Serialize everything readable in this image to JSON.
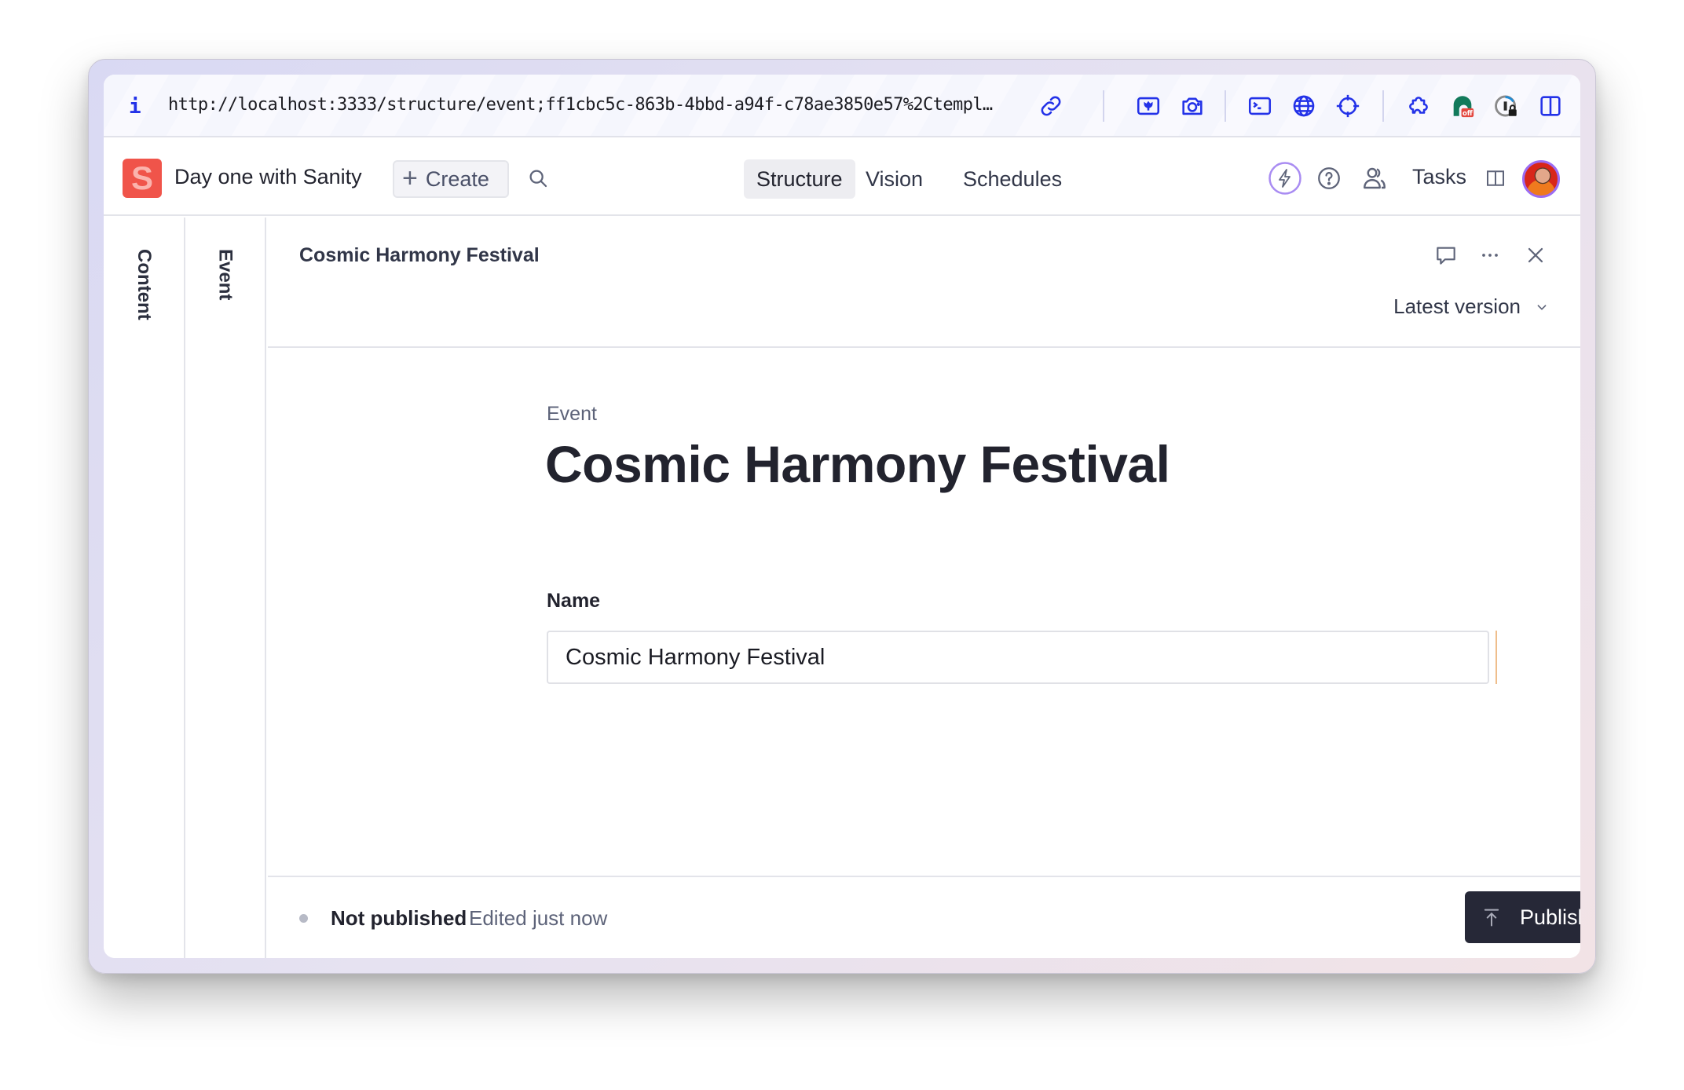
{
  "browser": {
    "url": "http://localhost:3333/structure/event;ff1cbc5c-863b-4bbd-a94f-c78ae3850e57%2Ctempl…",
    "info_icon": "i",
    "toolbar_icons": [
      "link-icon",
      "image-tool-icon",
      "camera-icon",
      "terminal-icon",
      "globe-icon",
      "crosshair-icon",
      "extension-puzzle-icon",
      "extension-off-icon",
      "password-manager-lock-icon",
      "sidebar-split-icon"
    ],
    "extension_badge": "off",
    "accent_color": "#2332e8"
  },
  "header": {
    "logo_letter": "S",
    "project_name": "Day one with Sanity",
    "create_label": "Create",
    "nav_tabs": [
      {
        "label": "Structure",
        "active": true
      },
      {
        "label": "Vision",
        "active": false
      },
      {
        "label": "Schedules",
        "active": false
      }
    ],
    "tasks_label": "Tasks",
    "brand_color": "#f0544a"
  },
  "columns": [
    {
      "label": "Content"
    },
    {
      "label": "Event"
    }
  ],
  "document": {
    "header_title": "Cosmic Harmony Festival",
    "version_label": "Latest version",
    "type_label": "Event",
    "title": "Cosmic Harmony Festival",
    "fields": [
      {
        "label": "Name",
        "value": "Cosmic Harmony Festival"
      }
    ]
  },
  "footer": {
    "status": "Not published",
    "edited": "Edited just now",
    "publish_label": "Publish",
    "publish_color": "#262837"
  }
}
